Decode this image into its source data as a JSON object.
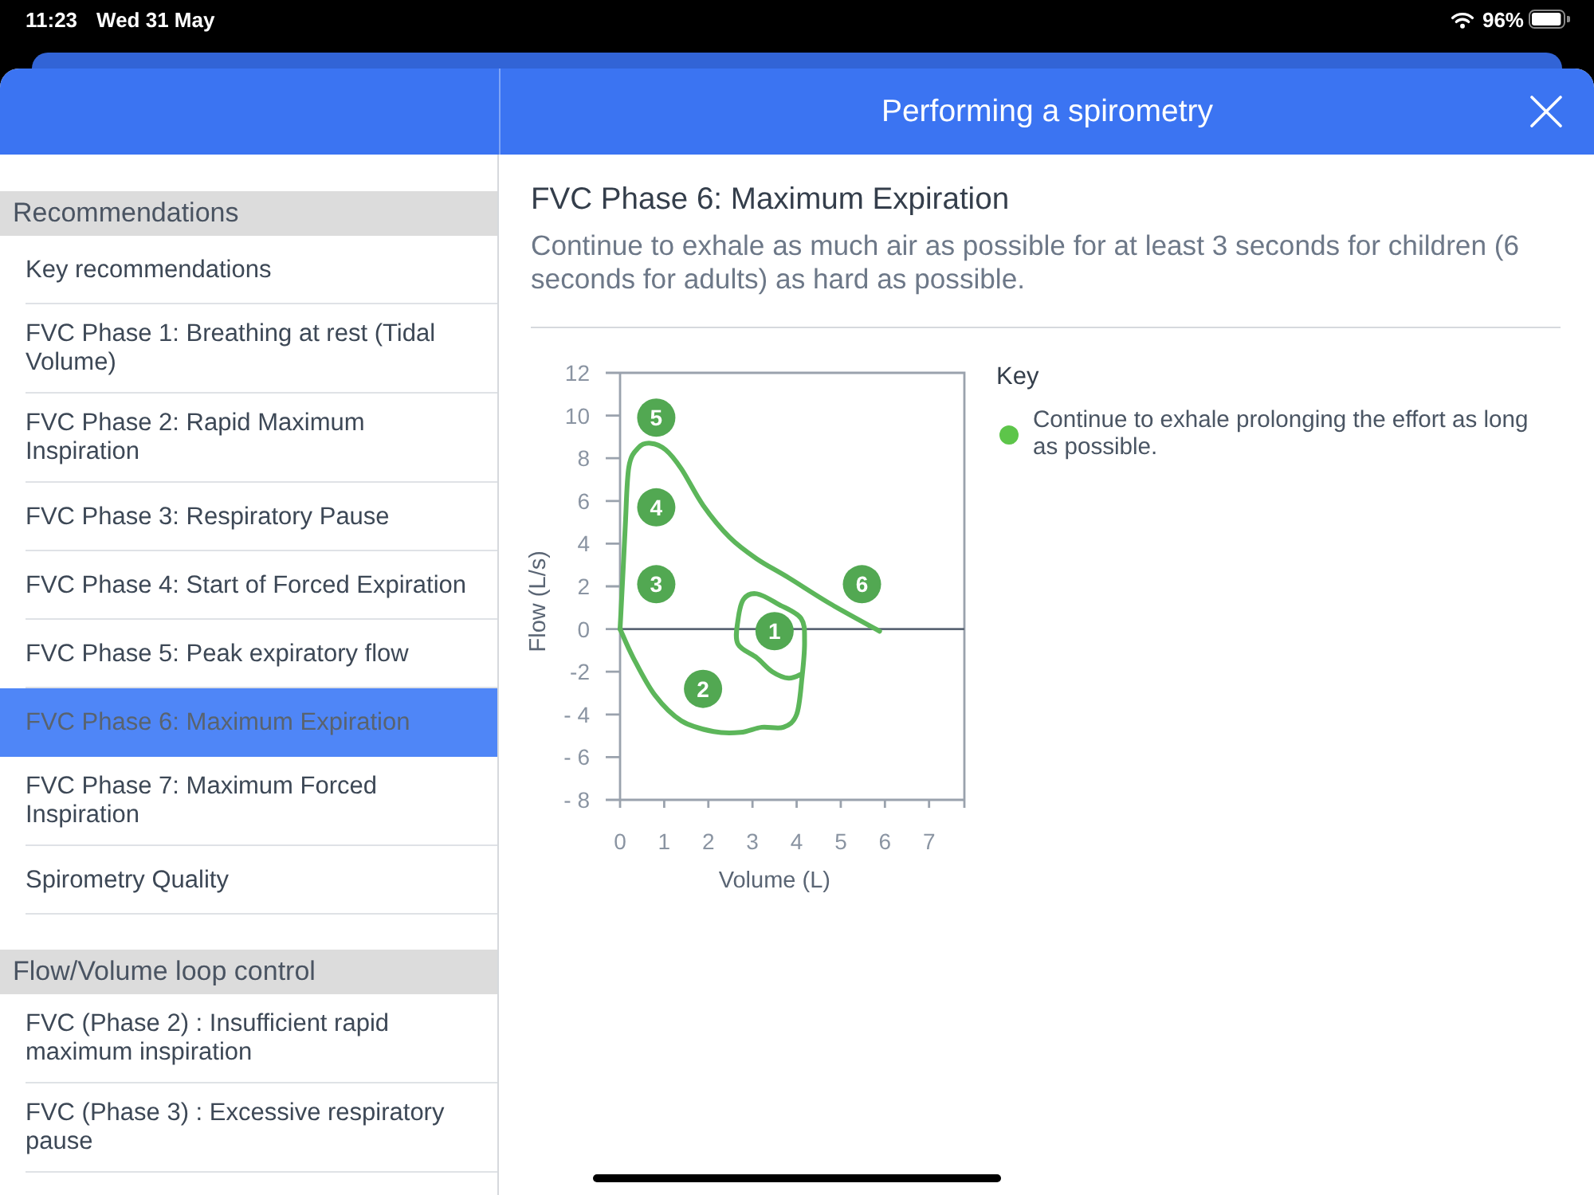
{
  "status_bar": {
    "time": "11:23",
    "date": "Wed 31 May",
    "battery": "96%"
  },
  "header": {
    "title": "Performing a spirometry"
  },
  "sidebar": {
    "sections": [
      {
        "title": "Recommendations",
        "items": [
          {
            "label": "Key recommendations",
            "selected": false
          },
          {
            "label": "FVC Phase 1: Breathing at rest (Tidal Volume)",
            "selected": false
          },
          {
            "label": "FVC Phase 2: Rapid Maximum Inspiration",
            "selected": false
          },
          {
            "label": "FVC Phase 3: Respiratory Pause",
            "selected": false
          },
          {
            "label": "FVC Phase 4: Start of Forced Expiration",
            "selected": false
          },
          {
            "label": "FVC Phase 5: Peak expiratory flow",
            "selected": false
          },
          {
            "label": "FVC Phase 6: Maximum Expiration",
            "selected": true
          },
          {
            "label": "FVC Phase 7: Maximum Forced Inspiration",
            "selected": false
          },
          {
            "label": "Spirometry Quality",
            "selected": false
          }
        ]
      },
      {
        "title": "Flow/Volume loop control",
        "items": [
          {
            "label": "FVC (Phase 2) : Insufficient rapid maximum inspiration",
            "selected": false
          },
          {
            "label": "FVC (Phase 3) : Excessive respiratory pause",
            "selected": false
          }
        ]
      }
    ]
  },
  "content": {
    "title": "FVC Phase 6: Maximum Expiration",
    "description": "Continue to exhale as much air as possible for at least 3 seconds for children (6 seconds for adults) as hard as possible.",
    "chart_data": [
      {
        "type": "line",
        "xlabel": "Volume (L)",
        "ylabel": "Flow (L/s)",
        "xlim": [
          0,
          7.8
        ],
        "ylim": [
          -8,
          12
        ],
        "xticks": [
          0,
          1,
          2,
          3,
          4,
          5,
          6,
          7
        ],
        "yticks": [
          {
            "value": -8,
            "label": "- 8"
          },
          {
            "value": -6,
            "label": "- 6"
          },
          {
            "value": -4,
            "label": "- 4"
          },
          -2,
          0,
          2,
          4,
          6,
          8,
          10,
          12
        ],
        "ref_lines": [
          {
            "axis": "y",
            "value": 0,
            "color": "#5b6675"
          }
        ],
        "series": [
          {
            "type": "line",
            "color": "#5cb65a",
            "x": [
              0,
              0.06,
              0.12,
              0.2,
              0.42,
              0.69,
              1.03,
              1.39,
              1.88,
              2.48,
              3.09,
              3.82,
              4.79,
              5.88
            ],
            "values": [
              0,
              2.4,
              4.9,
              7.6,
              8.5,
              8.7,
              8.4,
              7.5,
              5.8,
              4.3,
              3.3,
              2.4,
              1.15,
              -0.1
            ]
          },
          {
            "type": "line",
            "color": "#5cb65a",
            "x": [
              0,
              0.3,
              0.79,
              1.39,
              2.12,
              2.73,
              3.21,
              3.7,
              4.0,
              4.12,
              4.18,
              4.1,
              3.6,
              3.1,
              2.8,
              2.67,
              2.67,
              3.1,
              3.45,
              3.82,
              4.12
            ],
            "values": [
              0,
              -1.35,
              -3.1,
              -4.3,
              -4.8,
              -4.84,
              -4.6,
              -4.6,
              -4.0,
              -2.3,
              -0.6,
              0.5,
              1.15,
              1.65,
              1.4,
              0.4,
              -0.7,
              -1.35,
              -2.0,
              -2.3,
              -2.1
            ]
          },
          {
            "type": "scatter",
            "color": "#52a852",
            "x": [
              3.5,
              1.88,
              0.82,
              0.82,
              0.82,
              5.48
            ],
            "values": [
              -0.1,
              -2.8,
              2.1,
              5.7,
              9.9,
              2.1
            ]
          }
        ],
        "annotations": [
          "1",
          "2",
          "3",
          "4",
          "5",
          "6"
        ]
      }
    ],
    "key": {
      "title": "Key",
      "items": [
        {
          "label": "Continue to exhale prolonging the effort as long as possible.",
          "color": "#5dc54a"
        }
      ]
    }
  }
}
